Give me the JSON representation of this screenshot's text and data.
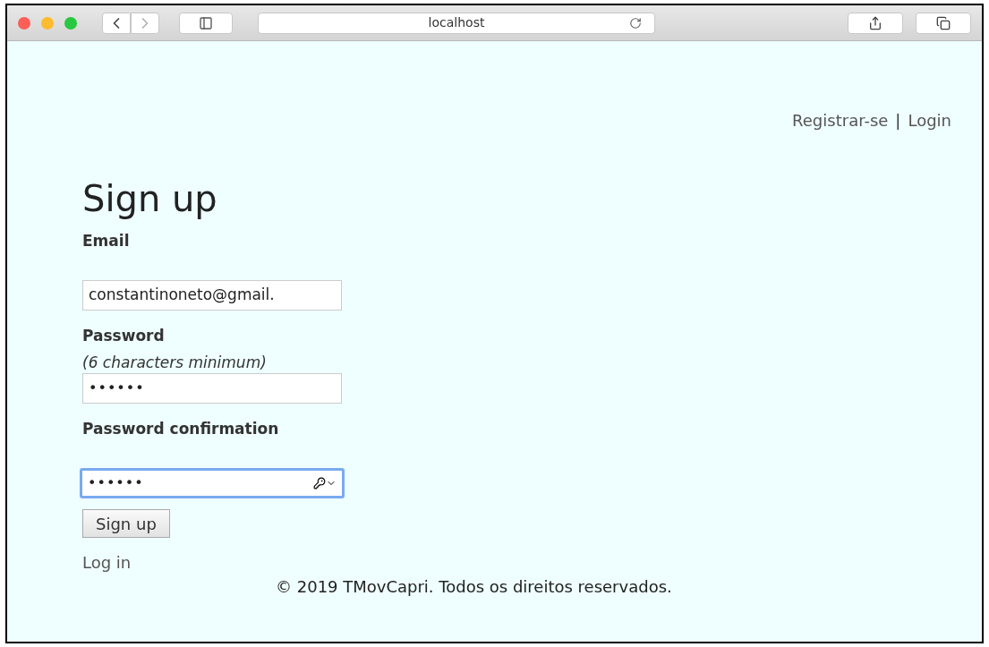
{
  "toolbar": {
    "url": "localhost",
    "back_disabled": false,
    "forward_disabled": true
  },
  "nav": {
    "links": [
      {
        "label": "Registrar-se"
      },
      {
        "label": "Login"
      }
    ],
    "separator": "|"
  },
  "heading": "Sign up",
  "fields": [
    {
      "label": "Email",
      "value": "constantinoneto@gmail.",
      "kind": "text",
      "focused": false
    },
    {
      "label": "Password",
      "hint": "(6 characters minimum)",
      "value": "••••••",
      "kind": "password",
      "focused": false
    },
    {
      "label": "Password confirmation",
      "value": "••••••",
      "kind": "password",
      "focused": true
    }
  ],
  "submit": "Sign up",
  "login_link": "Log in",
  "footer": "© 2019 TMovCapri. Todos os direitos reservados."
}
